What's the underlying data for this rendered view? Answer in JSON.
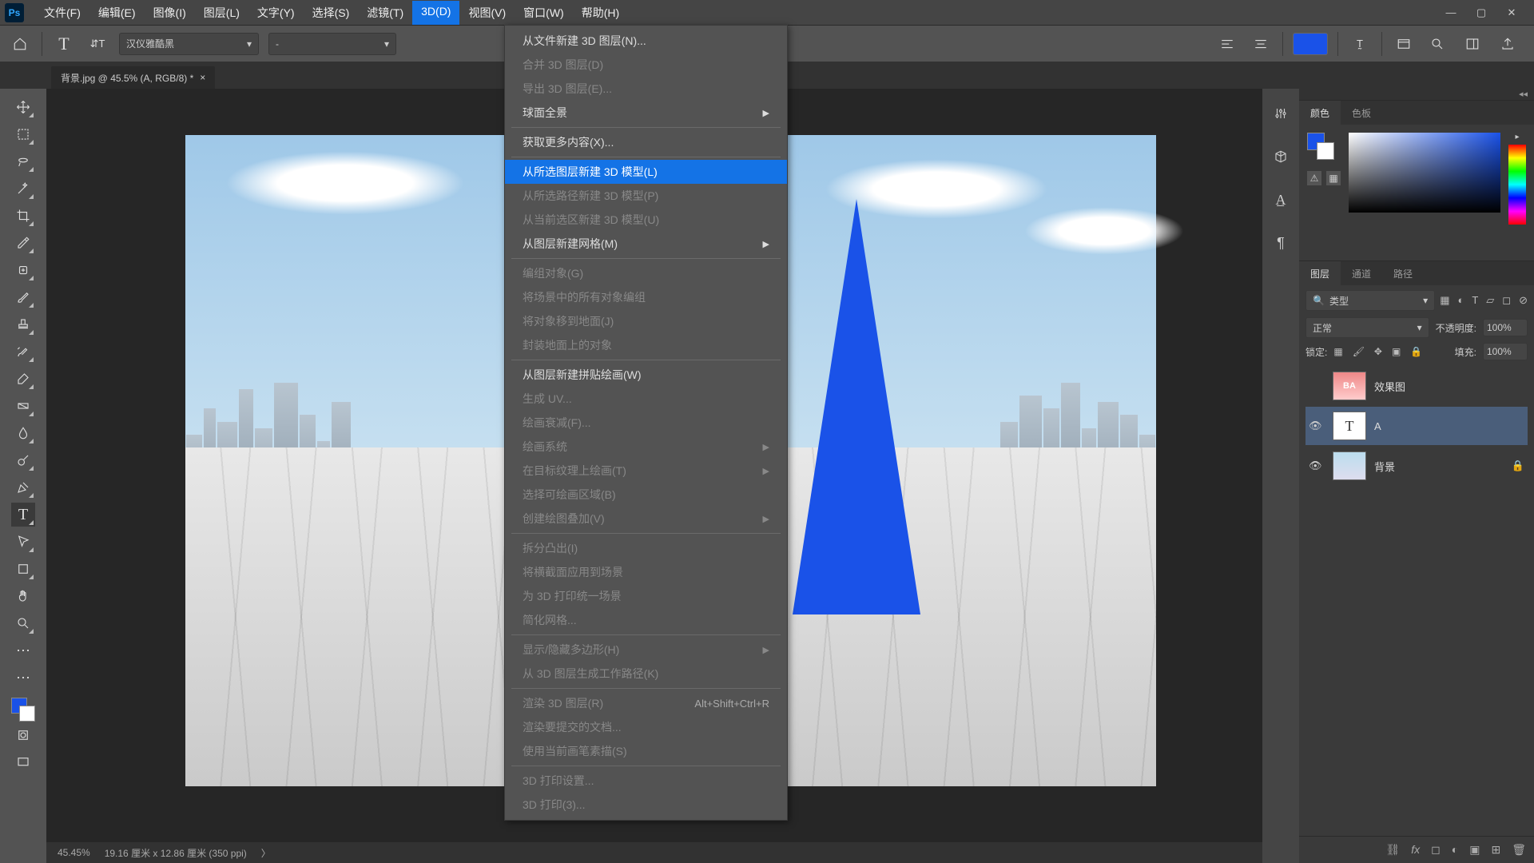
{
  "menubar": {
    "items": [
      "文件(F)",
      "编辑(E)",
      "图像(I)",
      "图层(L)",
      "文字(Y)",
      "选择(S)",
      "滤镜(T)",
      "3D(D)",
      "视图(V)",
      "窗口(W)",
      "帮助(H)"
    ],
    "active_index": 7
  },
  "options": {
    "font": "汉仪雅酷黑",
    "style": "-"
  },
  "doc_tab": "背景.jpg @ 45.5% (A, RGB/8) *",
  "dropdown": {
    "items": [
      {
        "t": "从文件新建 3D 图层(N)..."
      },
      {
        "t": "合并 3D 图层(D)",
        "disabled": true
      },
      {
        "t": "导出 3D 图层(E)...",
        "disabled": true
      },
      {
        "t": "球面全景",
        "sub": true
      },
      {
        "sep": true
      },
      {
        "t": "获取更多内容(X)..."
      },
      {
        "sep": true
      },
      {
        "t": "从所选图层新建 3D 模型(L)",
        "hl": true
      },
      {
        "t": "从所选路径新建 3D 模型(P)",
        "disabled": true
      },
      {
        "t": "从当前选区新建 3D 模型(U)",
        "disabled": true
      },
      {
        "t": "从图层新建网格(M)",
        "sub": true
      },
      {
        "sep": true
      },
      {
        "t": "编组对象(G)",
        "disabled": true
      },
      {
        "t": "将场景中的所有对象编组",
        "disabled": true
      },
      {
        "t": "将对象移到地面(J)",
        "disabled": true
      },
      {
        "t": "封装地面上的对象",
        "disabled": true
      },
      {
        "sep": true
      },
      {
        "t": "从图层新建拼贴绘画(W)"
      },
      {
        "t": "生成 UV...",
        "disabled": true
      },
      {
        "t": "绘画衰减(F)...",
        "disabled": true
      },
      {
        "t": "绘画系统",
        "sub": true,
        "disabled": true
      },
      {
        "t": "在目标纹理上绘画(T)",
        "sub": true,
        "disabled": true
      },
      {
        "t": "选择可绘画区域(B)",
        "disabled": true
      },
      {
        "t": "创建绘图叠加(V)",
        "sub": true,
        "disabled": true
      },
      {
        "sep": true
      },
      {
        "t": "拆分凸出(I)",
        "disabled": true
      },
      {
        "t": "将横截面应用到场景",
        "disabled": true
      },
      {
        "t": "为 3D 打印统一场景",
        "disabled": true
      },
      {
        "t": "简化网格...",
        "disabled": true
      },
      {
        "sep": true
      },
      {
        "t": "显示/隐藏多边形(H)",
        "sub": true,
        "disabled": true
      },
      {
        "t": "从 3D 图层生成工作路径(K)",
        "disabled": true
      },
      {
        "sep": true
      },
      {
        "t": "渲染 3D 图层(R)",
        "disabled": true,
        "sc": "Alt+Shift+Ctrl+R"
      },
      {
        "t": "渲染要提交的文档...",
        "disabled": true
      },
      {
        "t": "使用当前画笔素描(S)",
        "disabled": true
      },
      {
        "sep": true
      },
      {
        "t": "3D 打印设置...",
        "disabled": true
      },
      {
        "t": "3D 打印(3)...",
        "disabled": true
      }
    ]
  },
  "panels": {
    "color_tab": "颜色",
    "swatch_tab": "色板",
    "layers_tab": "图层",
    "channels_tab": "通道",
    "paths_tab": "路径",
    "kind": "类型",
    "blend": "正常",
    "opacity_label": "不透明度:",
    "opacity": "100%",
    "fill_label": "填充:",
    "fill": "100%",
    "lock_label": "锁定:",
    "layers": [
      {
        "name": "效果图",
        "vis": false
      },
      {
        "name": "A",
        "vis": true,
        "sel": true
      },
      {
        "name": "背景",
        "vis": true,
        "locked": true
      }
    ]
  },
  "status": {
    "zoom": "45.45%",
    "dims": "19.16 厘米 x 12.86 厘米 (350 ppi)"
  }
}
